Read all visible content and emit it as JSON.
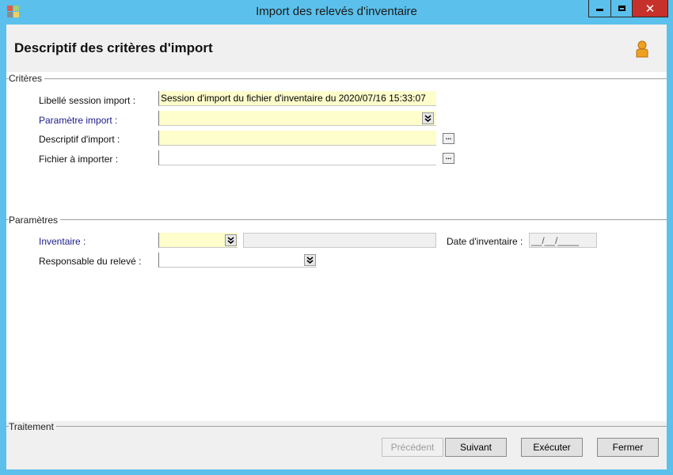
{
  "window": {
    "title": "Import des relevés d'inventaire",
    "minimize_glyph": "▬",
    "maximize_glyph": "□",
    "close_glyph": "✕"
  },
  "header": {
    "title": "Descriptif des critères d'import",
    "user_icon": "user-icon"
  },
  "criteres": {
    "group_label": "Critères",
    "libelle_label": "Libellé session import :",
    "libelle_value": "Session d'import du fichier d'inventaire du 2020/07/16 15:33:07",
    "parametre_label": "Paramètre import :",
    "parametre_value": "",
    "descriptif_label": "Descriptif d'import :",
    "descriptif_value": "",
    "descriptif_browse": "...",
    "fichier_label": "Fichier à importer :",
    "fichier_value": "",
    "fichier_browse": "..."
  },
  "parametres": {
    "group_label": "Paramètres",
    "inventaire_label": "Inventaire :",
    "inventaire_value": "",
    "inventaire_desc": "",
    "date_label": "Date d'inventaire :",
    "date_value": "__/__/____",
    "responsable_label": "Responsable du relevé :",
    "responsable_value": ""
  },
  "traitement": {
    "group_label": "Traitement",
    "precedent_label": "Précédent",
    "suivant_label": "Suivant",
    "executer_label": "Exécuter",
    "fermer_label": "Fermer"
  },
  "colors": {
    "title_bar": "#5bc0eb",
    "close_button": "#c7312b",
    "mandatory_field": "#fefdcc",
    "blue_label": "#1c1c8c"
  }
}
